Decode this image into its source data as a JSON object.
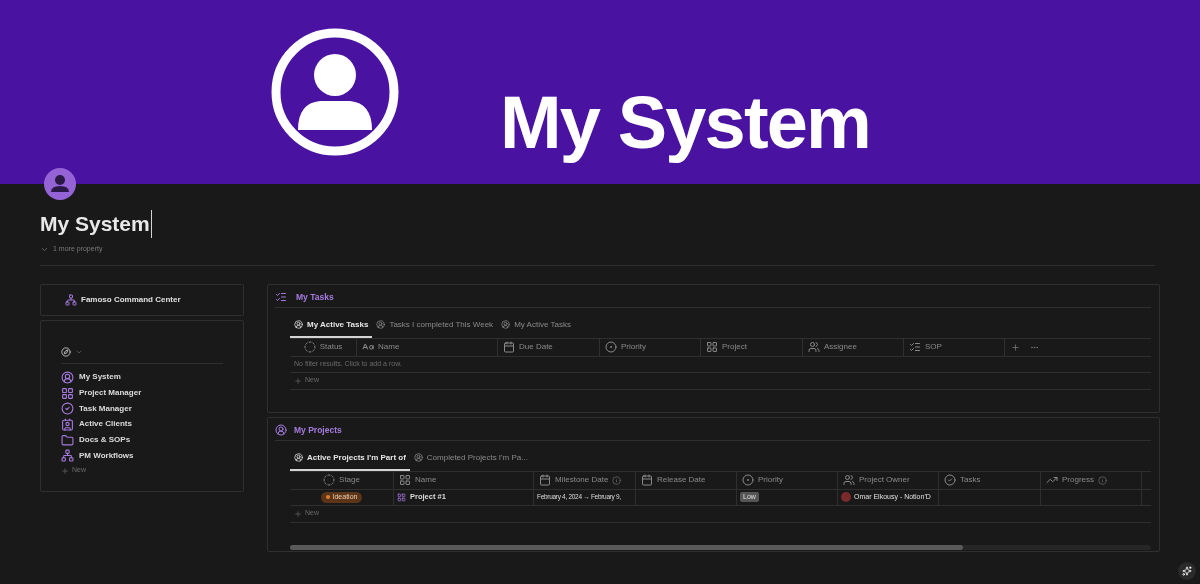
{
  "banner": {
    "title": "My System"
  },
  "page": {
    "title": "My System",
    "more_properties": "1 more property"
  },
  "sidebar": {
    "header": "Famoso Command Center",
    "nav_items": [
      {
        "label": "My System",
        "kind": "person"
      },
      {
        "label": "Project Manager",
        "kind": "grid"
      },
      {
        "label": "Task Manager",
        "kind": "check"
      },
      {
        "label": "Active Clients",
        "kind": "card"
      },
      {
        "label": "Docs & SOPs",
        "kind": "folder"
      },
      {
        "label": "PM Workflows",
        "kind": "workflow"
      }
    ],
    "new_label": "New"
  },
  "tasks": {
    "title": "My Tasks",
    "tabs": [
      {
        "label": "My Active Tasks",
        "selected": true
      },
      {
        "label": "Tasks I completed This Week",
        "selected": false
      },
      {
        "label": "My Active Tasks",
        "selected": false
      }
    ],
    "columns": [
      {
        "label": "Status",
        "kind": "status"
      },
      {
        "label": "Name",
        "kind": "title"
      },
      {
        "label": "Due Date",
        "kind": "date"
      },
      {
        "label": "Priority",
        "kind": "select"
      },
      {
        "label": "Project",
        "kind": "relation"
      },
      {
        "label": "Assignee",
        "kind": "person"
      },
      {
        "label": "SOP",
        "kind": "list"
      }
    ],
    "empty_message": "No filter results. Click to add a row.",
    "new_label": "New"
  },
  "projects": {
    "title": "My Projects",
    "tabs": [
      {
        "label": "Active Projects I'm Part of",
        "selected": true
      },
      {
        "label": "Completed Projects I'm Pa...",
        "selected": false
      }
    ],
    "columns": [
      {
        "label": "Stage",
        "kind": "status",
        "info": false
      },
      {
        "label": "Name",
        "kind": "relation",
        "info": false
      },
      {
        "label": "Milestone Date",
        "kind": "date",
        "info": true
      },
      {
        "label": "Release Date",
        "kind": "date",
        "info": false
      },
      {
        "label": "Priority",
        "kind": "select",
        "info": false
      },
      {
        "label": "Project Owner",
        "kind": "person",
        "info": false
      },
      {
        "label": "Tasks",
        "kind": "check",
        "info": false
      },
      {
        "label": "Progress",
        "kind": "chart",
        "info": true
      }
    ],
    "rows": [
      {
        "stage": {
          "label": "Ideation",
          "color": "#e0812f"
        },
        "name": "Project #1",
        "milestone_date": "February 4, 2024 → February 9,",
        "priority": "Low",
        "project_owner": "Omar Elkousy - Notion'D"
      }
    ],
    "new_label": "New"
  }
}
